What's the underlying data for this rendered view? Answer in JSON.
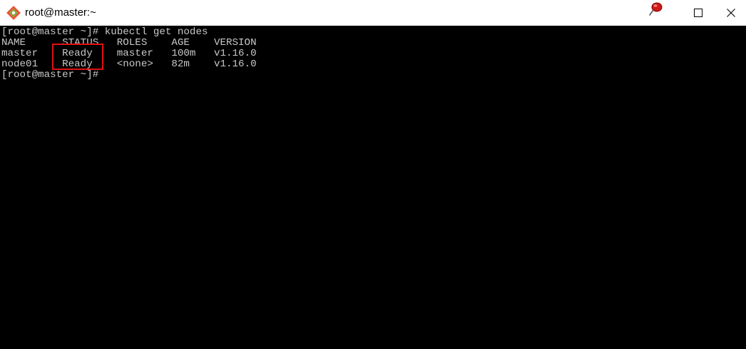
{
  "window": {
    "title": "root@master:~",
    "icons": {
      "app": "git-icon",
      "pin": "red-pushpin-icon",
      "maximize": "maximize-icon",
      "close": "close-icon"
    }
  },
  "terminal": {
    "lines": [
      "[root@master ~]# kubectl get nodes",
      "NAME      STATUS   ROLES    AGE    VERSION",
      "master    Ready    master   100m   v1.16.0",
      "node01    Ready    <none>   82m    v1.16.0",
      "[root@master ~]#"
    ],
    "annotation_color": "#e01010"
  }
}
